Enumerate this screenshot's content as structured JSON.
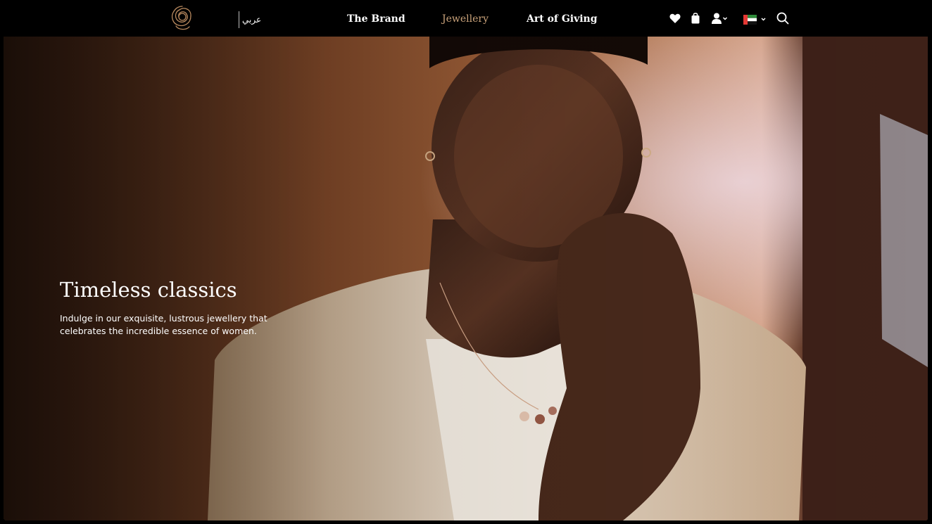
{
  "header": {
    "language_toggle": "عربي",
    "nav": {
      "brand": "The Brand",
      "jewellery": "Jewellery",
      "art_of_giving": "Art of Giving"
    },
    "active_nav": "Jewellery",
    "icons": [
      "rose-logo",
      "heart-icon",
      "bag-icon",
      "user-icon",
      "uae-flag-icon",
      "search-icon"
    ]
  },
  "hero": {
    "title": "Timeless classics",
    "description": "Indulge in our exquisite, lustrous jewellery that celebrates the incredible essence of women."
  },
  "colors": {
    "header_bg": "#000000",
    "nav_text": "#ffffff",
    "nav_active": "#c9a27a",
    "logo_gold": "#b8895e"
  }
}
